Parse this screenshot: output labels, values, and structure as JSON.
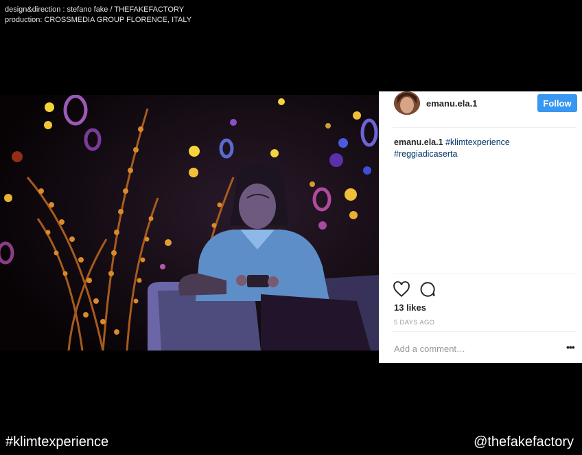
{
  "credits": {
    "line1": "design&direction : stefano fake / THEFAKEFACTORY",
    "line2": "production: CROSSMEDIA GROUP FLORENCE, ITALY"
  },
  "post": {
    "username": "emanu.ela.1",
    "follow_label": "Follow",
    "caption_user": "emanu.ela.1",
    "tag1": "#klimtexperience",
    "tag2": "#reggiadicaserta",
    "likes": "13 likes",
    "time": "5 DAYS AGO",
    "comment_placeholder": "Add a comment…",
    "more": "•••",
    "colors": {
      "follow": "#3897f0",
      "hashtag": "#003569"
    }
  },
  "footer": {
    "hashtag": "#klimtexperience",
    "handle": "@thefakefactory"
  },
  "icons": [
    "heart-icon",
    "comment-icon",
    "more-options-icon"
  ]
}
